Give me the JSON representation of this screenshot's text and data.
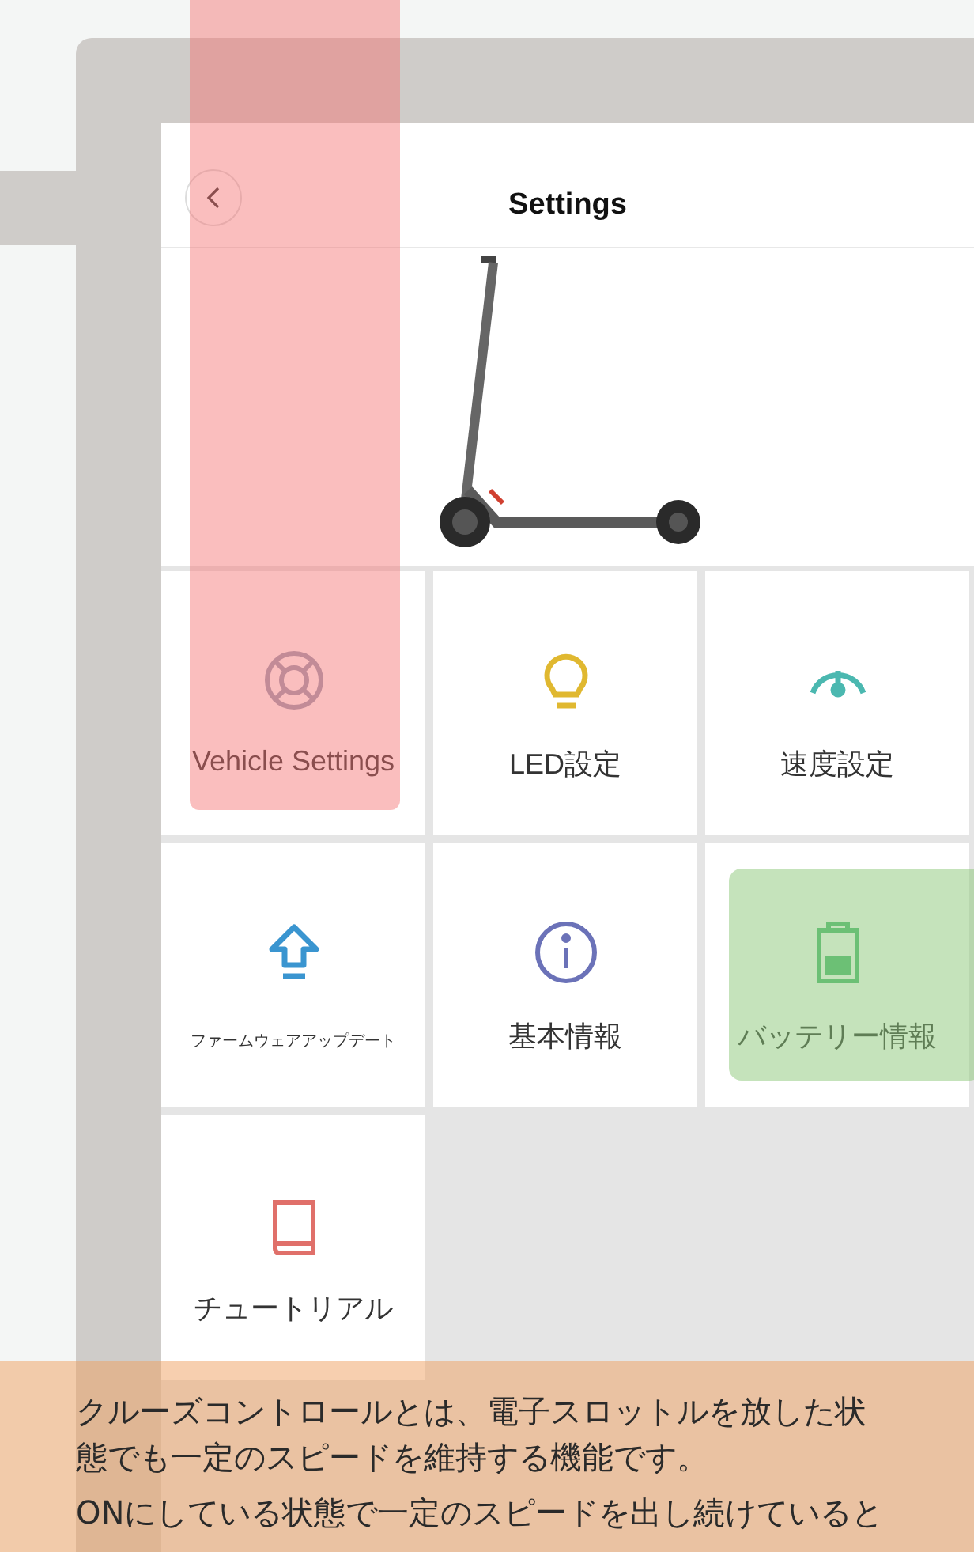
{
  "header": {
    "title": "Settings"
  },
  "tiles": [
    {
      "label": "Vehicle Settings",
      "kind": "lifebuoy"
    },
    {
      "label": "LED設定",
      "kind": "bulb"
    },
    {
      "label": "速度設定",
      "kind": "gauge"
    },
    {
      "label": "ファームウェアアップデート",
      "kind": "upload",
      "small": true
    },
    {
      "label": "基本情報",
      "kind": "info"
    },
    {
      "label": "バッテリー情報",
      "kind": "battery"
    },
    {
      "label": "チュートリアル",
      "kind": "book"
    }
  ],
  "note": {
    "paragraphs": [
      "クルーズコントロールとは、電子スロットルを放した状態でも一定のスピードを維持する機能です。",
      "ONにしている状態で一定のスピードを出し続けていると"
    ]
  }
}
